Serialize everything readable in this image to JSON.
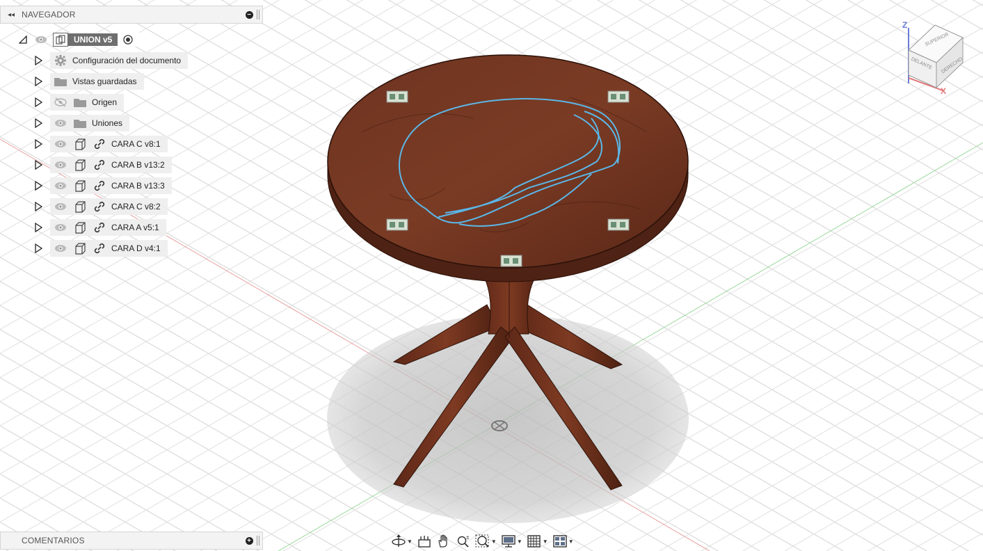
{
  "navigator": {
    "collapse_glyph": "◂◂",
    "title": "NAVEGADOR",
    "collapse_btn": "−",
    "root": {
      "label": "UNION v5"
    },
    "items": [
      {
        "label": "Configuración del documento",
        "icon": "gear-icon"
      },
      {
        "label": "Vistas guardadas",
        "icon": "folder-icon"
      },
      {
        "label": "Origen",
        "icon": "folder-icon",
        "visible": false
      },
      {
        "label": "Uniones",
        "icon": "folder-icon",
        "visible": true
      },
      {
        "label": "CARA C v8:1",
        "icon": "component-icon"
      },
      {
        "label": "CARA B v13:2",
        "icon": "component-icon"
      },
      {
        "label": "CARA B v13:3",
        "icon": "component-icon"
      },
      {
        "label": "CARA C v8:2",
        "icon": "component-icon"
      },
      {
        "label": "CARA A v5:1",
        "icon": "component-icon"
      },
      {
        "label": "CARA D v4:1",
        "icon": "component-icon"
      }
    ]
  },
  "comments": {
    "title": "COMENTARIOS",
    "add_btn": "+"
  },
  "viewcube": {
    "top_face": "SUPERIOR",
    "front_face": "DELANTE",
    "right_face": "DERECHO",
    "z_label": "Z",
    "x_label": "X"
  },
  "toolbar": {
    "icons": [
      "orbit-icon",
      "look-at-icon",
      "pan-icon",
      "zoom-icon",
      "fit-icon",
      "display-settings-icon",
      "grid-settings-icon",
      "viewports-icon"
    ]
  },
  "colors": {
    "wood": "#6b2f1c",
    "wood_light": "#7d3c24",
    "sketch": "#5bb7e8",
    "axis_x": "#e27a7a",
    "axis_y": "#8fd18f",
    "axis_z": "#6a7bd8"
  }
}
